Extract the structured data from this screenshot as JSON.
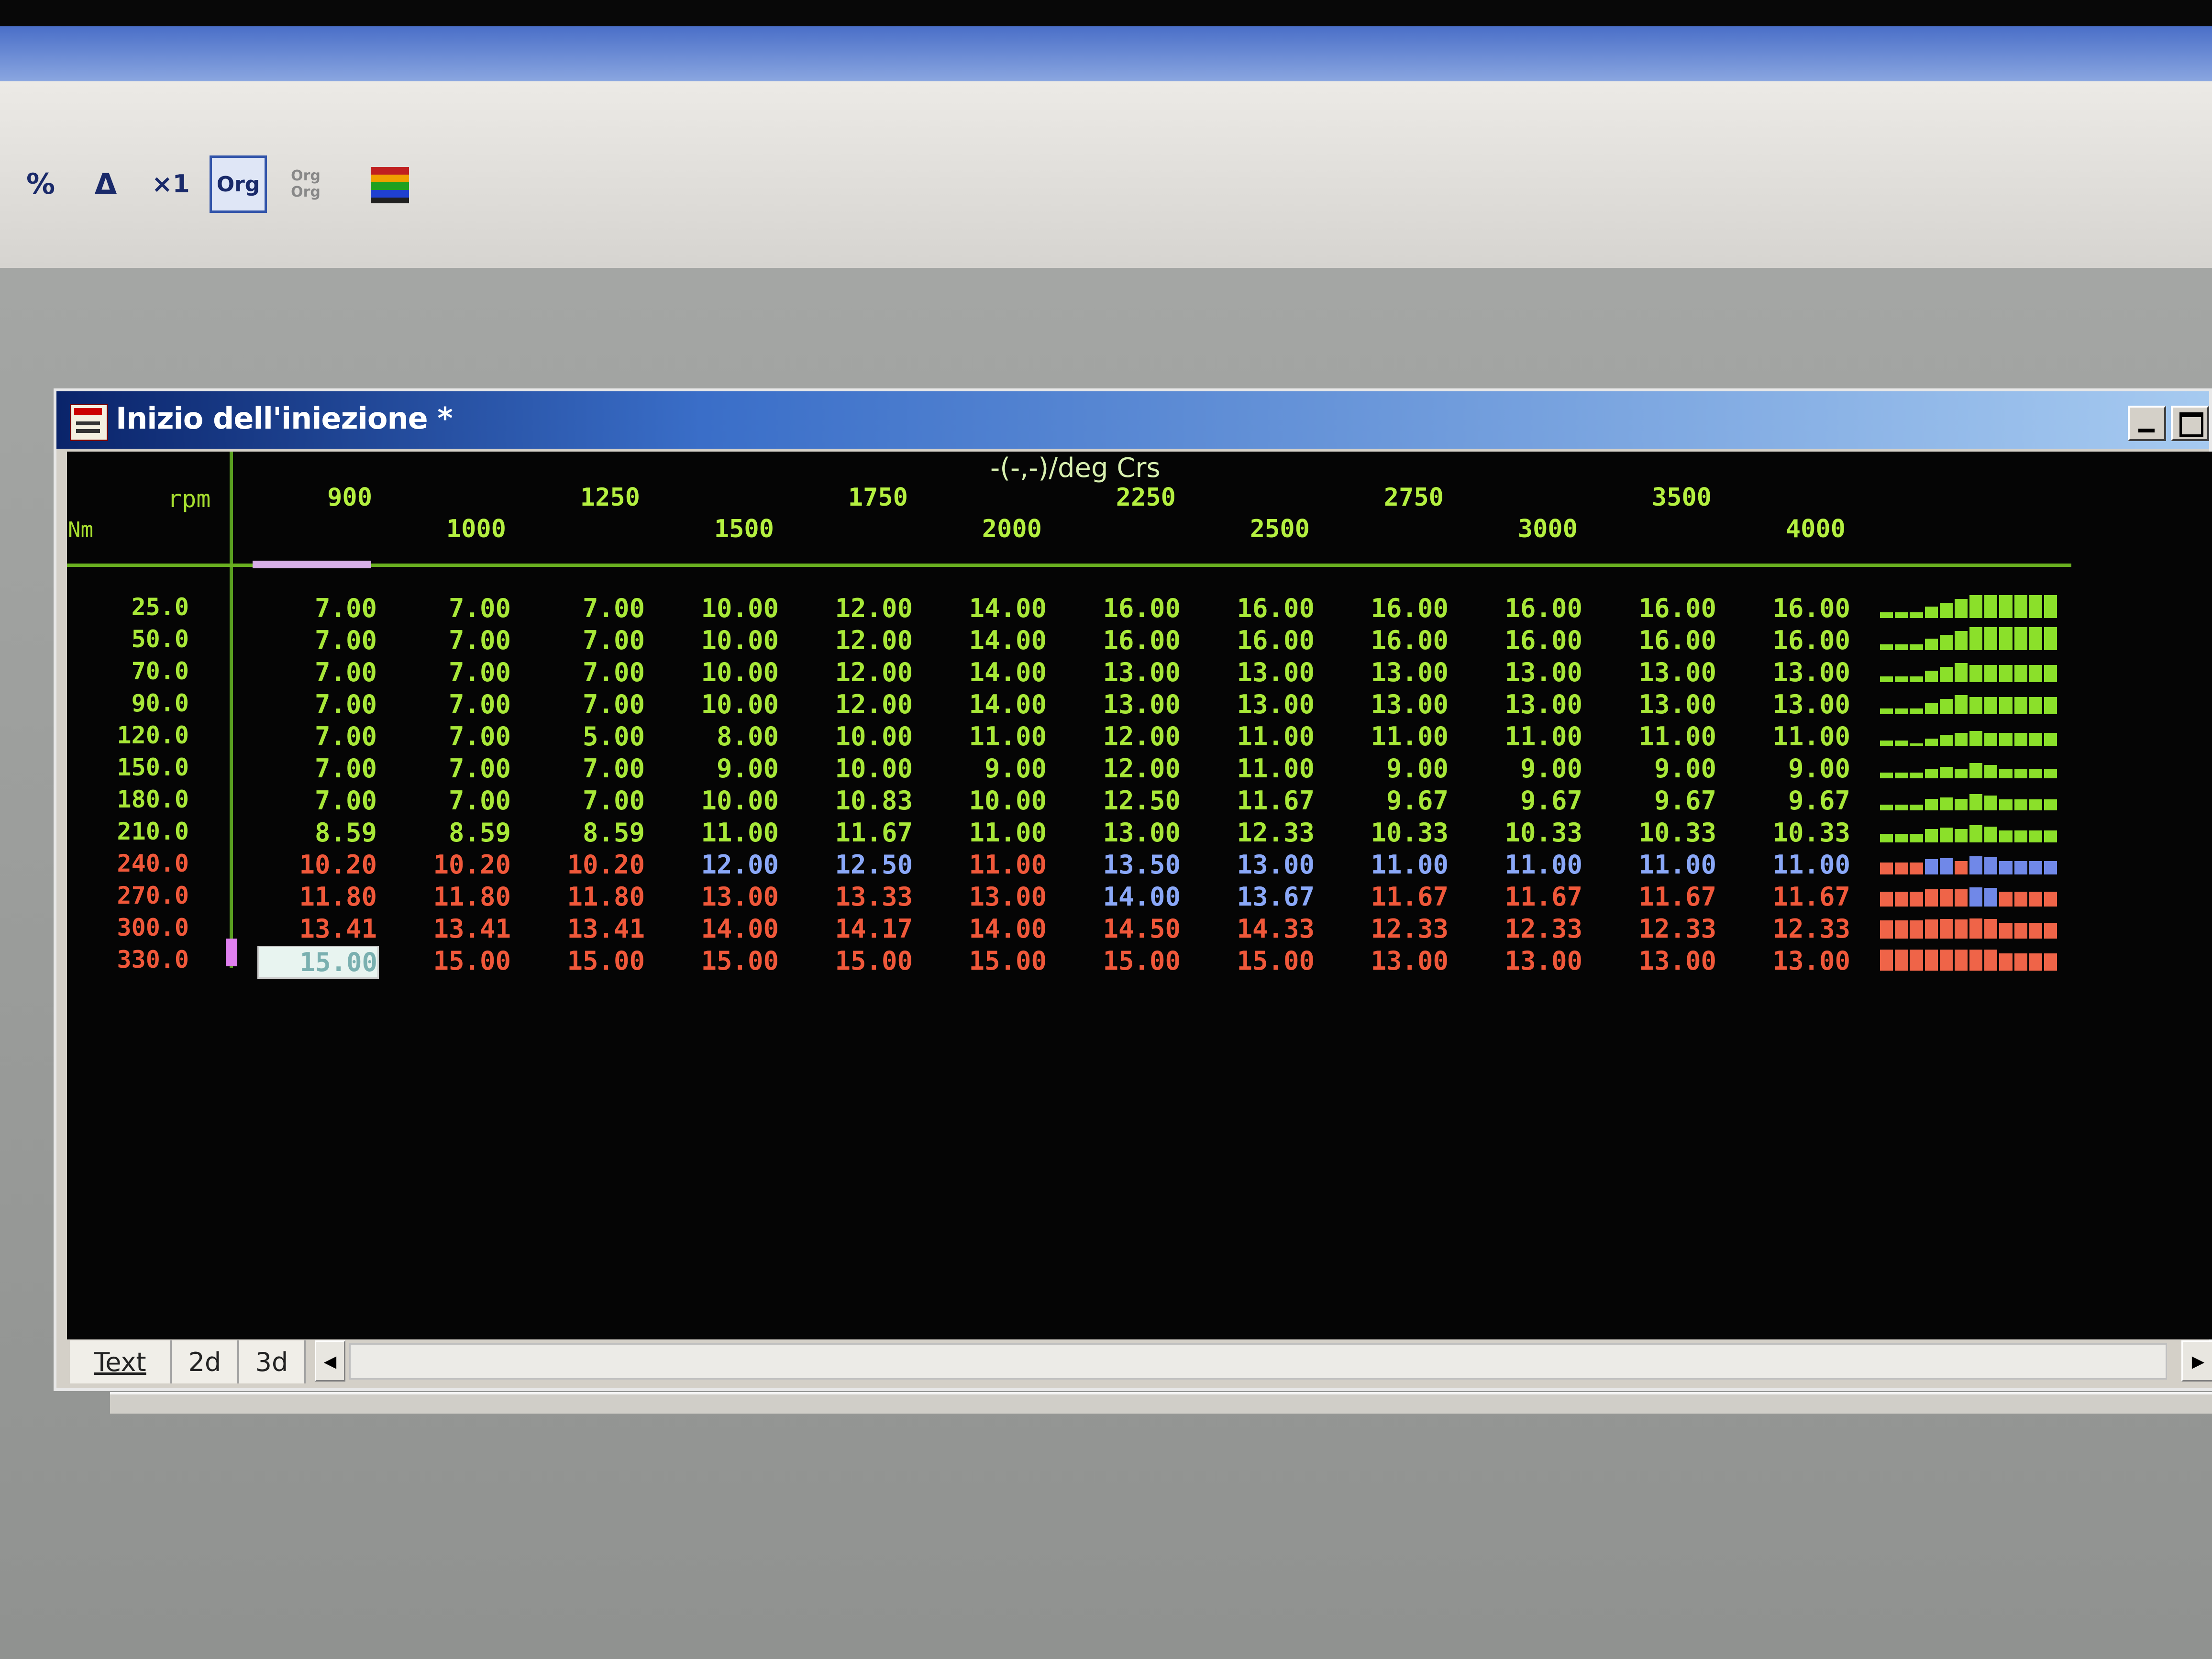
{
  "toolbar": {
    "row1": [
      {
        "name": "percent-button",
        "glyph": "%",
        "pressed": false
      },
      {
        "name": "delta-button",
        "glyph": "Δ",
        "pressed": false
      },
      {
        "name": "times-one-button",
        "glyph": "×1",
        "pressed": false
      },
      {
        "name": "org-button",
        "glyph": "Org",
        "pressed": true
      },
      {
        "name": "org-compare-button",
        "glyph": "Org Org",
        "pressed": false
      }
    ],
    "help_placeholder": "?"
  },
  "window": {
    "title": "Inizio dell'iniezione *",
    "unit": "-(-,-)/deg Crs",
    "rpm_label": "rpm",
    "nm_label": "Nm",
    "rpm_values": [
      "900",
      "1000",
      "1250",
      "1500",
      "1750",
      "2000",
      "2250",
      "2500",
      "2750",
      "3000",
      "3500",
      "4000"
    ],
    "rows": [
      {
        "nm": "25.0",
        "values": [
          "7.00",
          "7.00",
          "7.00",
          "10.00",
          "12.00",
          "14.00",
          "16.00",
          "16.00",
          "16.00",
          "16.00",
          "16.00",
          "16.00"
        ]
      },
      {
        "nm": "50.0",
        "values": [
          "7.00",
          "7.00",
          "7.00",
          "10.00",
          "12.00",
          "14.00",
          "16.00",
          "16.00",
          "16.00",
          "16.00",
          "16.00",
          "16.00"
        ]
      },
      {
        "nm": "70.0",
        "values": [
          "7.00",
          "7.00",
          "7.00",
          "10.00",
          "12.00",
          "14.00",
          "13.00",
          "13.00",
          "13.00",
          "13.00",
          "13.00",
          "13.00"
        ]
      },
      {
        "nm": "90.0",
        "values": [
          "7.00",
          "7.00",
          "7.00",
          "10.00",
          "12.00",
          "14.00",
          "13.00",
          "13.00",
          "13.00",
          "13.00",
          "13.00",
          "13.00"
        ]
      },
      {
        "nm": "120.0",
        "values": [
          "7.00",
          "7.00",
          "5.00",
          "8.00",
          "10.00",
          "11.00",
          "12.00",
          "11.00",
          "11.00",
          "11.00",
          "11.00",
          "11.00"
        ]
      },
      {
        "nm": "150.0",
        "values": [
          "7.00",
          "7.00",
          "7.00",
          "9.00",
          "10.00",
          "9.00",
          "12.00",
          "11.00",
          "9.00",
          "9.00",
          "9.00",
          "9.00"
        ]
      },
      {
        "nm": "180.0",
        "values": [
          "7.00",
          "7.00",
          "7.00",
          "10.00",
          "10.83",
          "10.00",
          "12.50",
          "11.67",
          "9.67",
          "9.67",
          "9.67",
          "9.67"
        ]
      },
      {
        "nm": "210.0",
        "values": [
          "8.59",
          "8.59",
          "8.59",
          "11.00",
          "11.67",
          "11.00",
          "13.00",
          "12.33",
          "10.33",
          "10.33",
          "10.33",
          "10.33"
        ]
      },
      {
        "nm": "240.0",
        "values": [
          "10.20",
          "10.20",
          "10.20",
          "12.00",
          "12.50",
          "11.00",
          "13.50",
          "13.00",
          "11.00",
          "11.00",
          "11.00",
          "11.00"
        ]
      },
      {
        "nm": "270.0",
        "values": [
          "11.80",
          "11.80",
          "11.80",
          "13.00",
          "13.33",
          "13.00",
          "14.00",
          "13.67",
          "11.67",
          "11.67",
          "11.67",
          "11.67"
        ]
      },
      {
        "nm": "300.0",
        "values": [
          "13.41",
          "13.41",
          "13.41",
          "14.00",
          "14.17",
          "14.00",
          "14.50",
          "14.33",
          "12.33",
          "12.33",
          "12.33",
          "12.33"
        ]
      },
      {
        "nm": "330.0",
        "values": [
          "15.00",
          "15.00",
          "15.00",
          "15.00",
          "15.00",
          "15.00",
          "15.00",
          "15.00",
          "13.00",
          "13.00",
          "13.00",
          "13.00"
        ]
      }
    ],
    "selected_cell": {
      "row": 11,
      "col": 0
    }
  },
  "tabs": [
    {
      "label": "Text",
      "active": true
    },
    {
      "label": "2d",
      "active": false
    },
    {
      "label": "3d",
      "active": false
    }
  ],
  "colors": {
    "green": "#a8e838",
    "red": "#f0583a",
    "blue": "#8aa8f8",
    "spark_green": "#8be02a",
    "spark_red": "#ef6448",
    "spark_blue": "#7088e8"
  }
}
